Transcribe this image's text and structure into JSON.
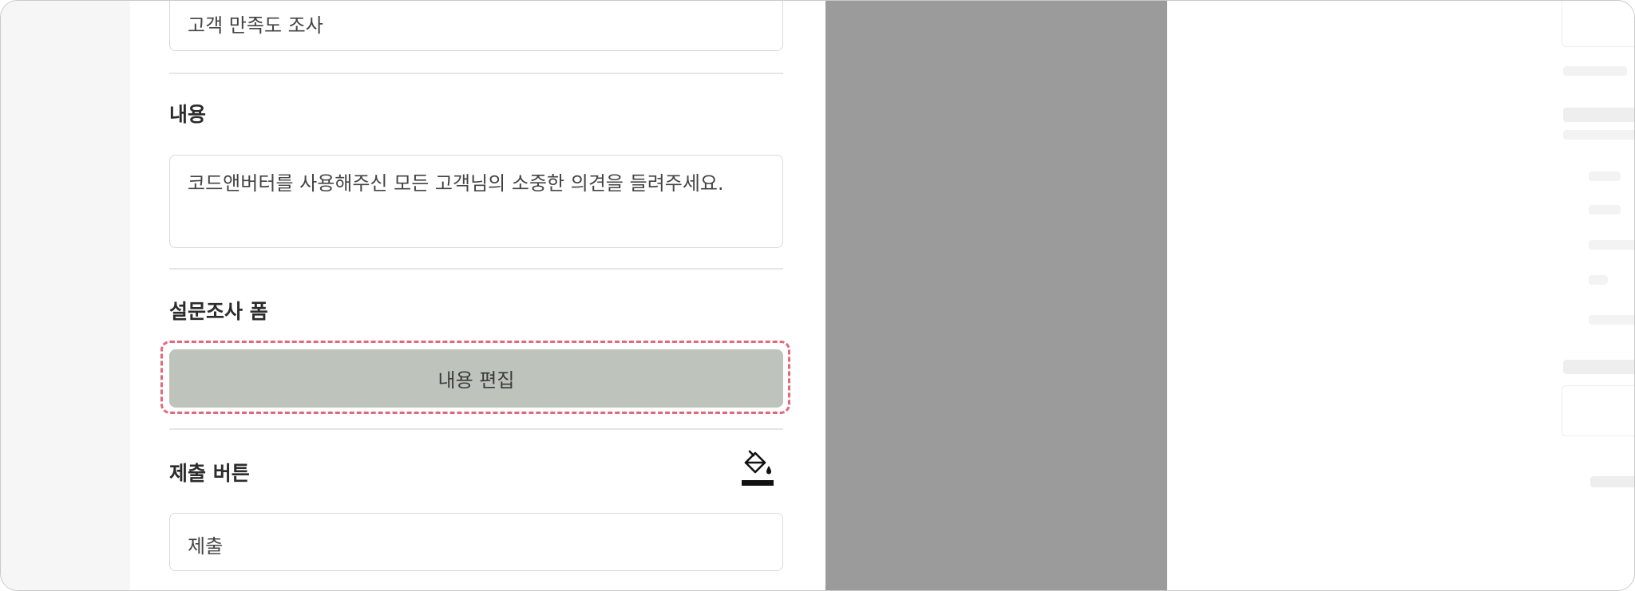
{
  "form": {
    "title_value": "고객 만족도 조사",
    "content_label": "내용",
    "content_value": "코드앤버터를 사용해주신 모든 고객님의 소중한 의견을 들려주세요.",
    "survey_form_label": "설문조사 폼",
    "edit_button_label": "내용 편집",
    "submit_button_label": "제출 버튼",
    "submit_value": "제출"
  },
  "colors": {
    "edit_button_bg": "#bec4bb",
    "focus_outline": "#e06a7c",
    "preview_overlay": "#9b9b9b"
  },
  "icons": {
    "paint": "paint-bucket-icon"
  }
}
